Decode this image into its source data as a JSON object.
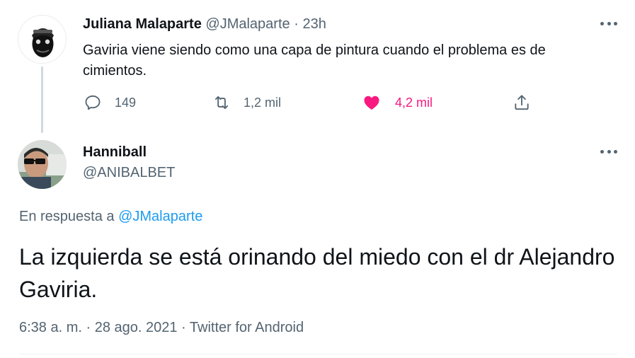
{
  "parent_tweet": {
    "author_name": "Juliana Malaparte",
    "author_handle": "@JMalaparte",
    "separator": "·",
    "time": "23h",
    "text": "Gaviria viene siendo como una capa de pintura cuando el problema es de cimientos.",
    "actions": {
      "reply_count": "149",
      "retweet_count": "1,2 mil",
      "like_count": "4,2 mil"
    }
  },
  "reply_tweet": {
    "author_name": "Hanniball",
    "author_handle": "@ANIBALBET",
    "reply_to_prefix": "En respuesta a",
    "reply_to_handle": "@JMalaparte",
    "text": "La izquierda se está orinando del miedo con el dr Alejandro Gaviria.",
    "meta": "6:38 a. m. · 28 ago. 2021 · Twitter for Android"
  },
  "icons": {
    "more": "more-icon",
    "reply": "reply-icon",
    "retweet": "retweet-icon",
    "like": "heart-icon",
    "share": "share-icon"
  },
  "colors": {
    "text_primary": "#0f1419",
    "text_secondary": "#536471",
    "link": "#1d9bf0",
    "like": "#f91880",
    "thread_line": "#cfd9de"
  }
}
